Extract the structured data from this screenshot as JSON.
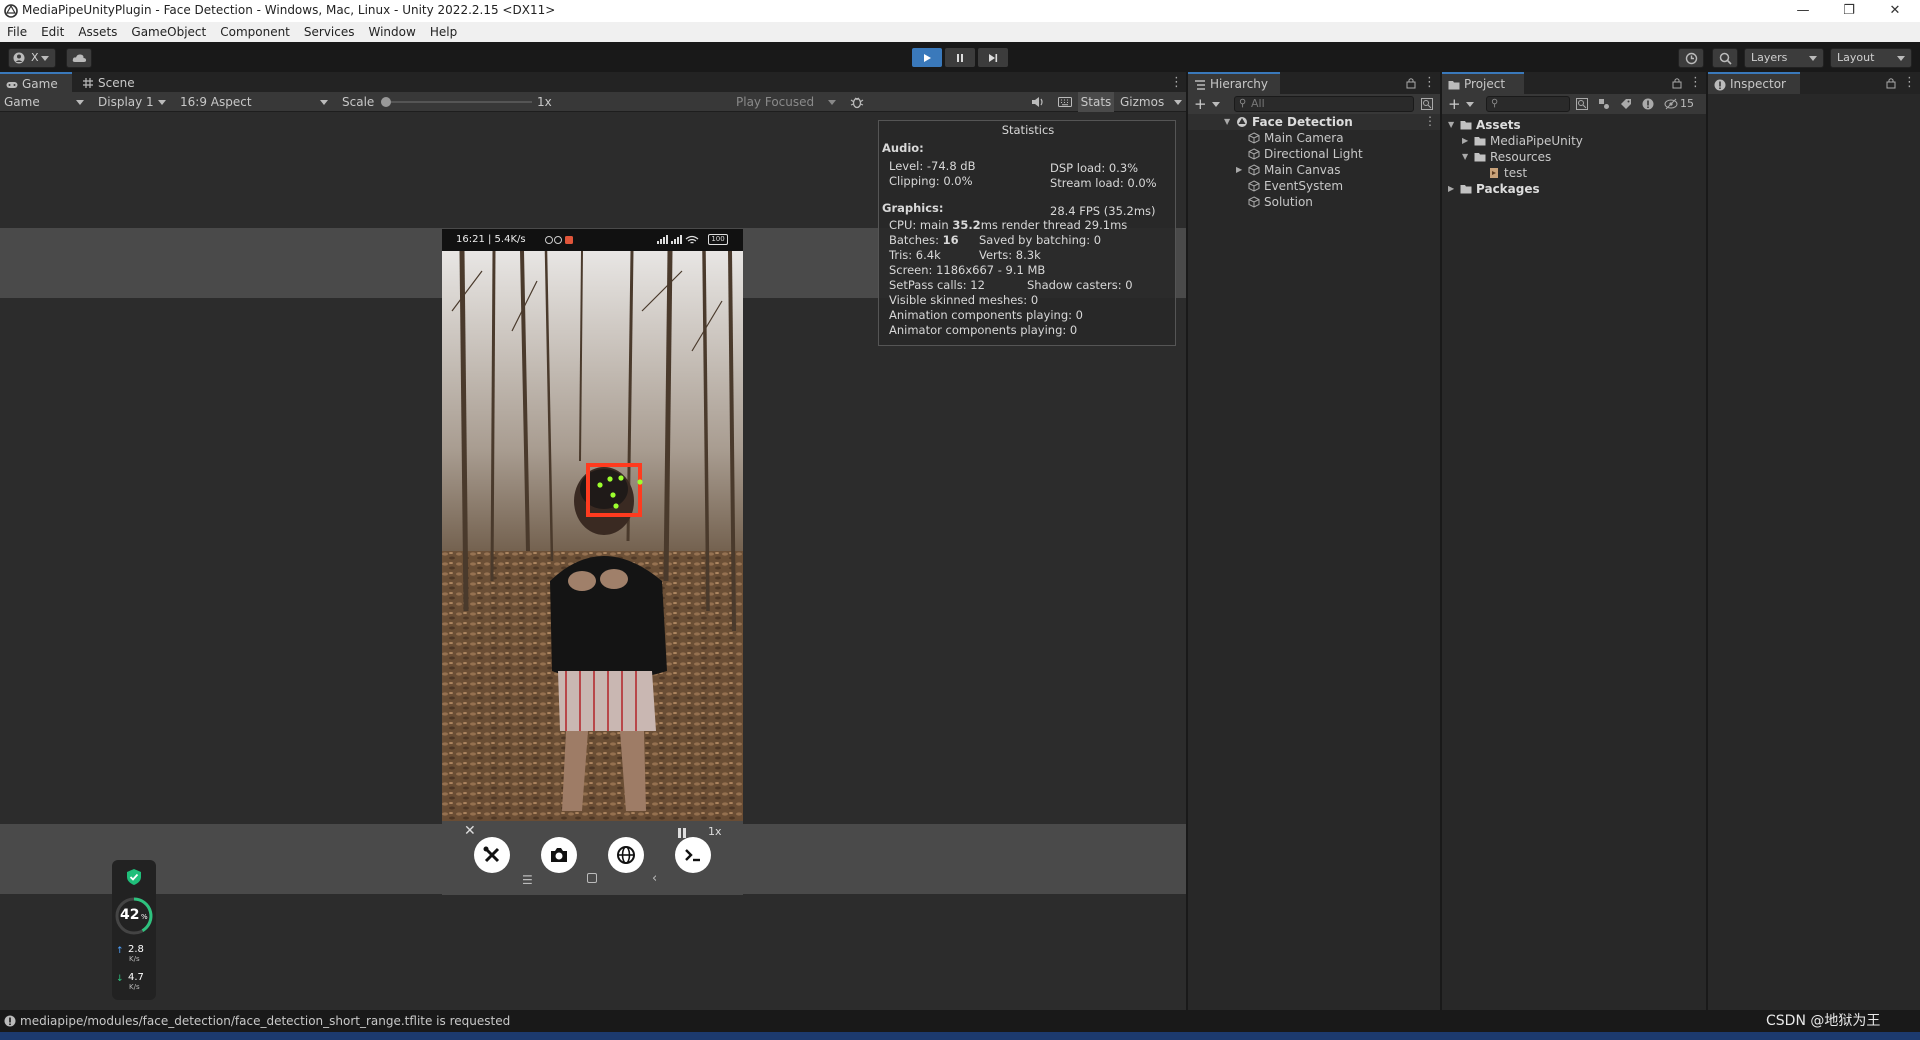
{
  "window": {
    "title": "MediaPipeUnityPlugin - Face Detection - Windows, Mac, Linux - Unity 2022.2.15 <DX11>",
    "minimize": "—",
    "restore": "❐",
    "close": "✕"
  },
  "menu": [
    "File",
    "Edit",
    "Assets",
    "GameObject",
    "Component",
    "Services",
    "Window",
    "Help"
  ],
  "toolbar": {
    "account_label": "X",
    "layers_label": "Layers",
    "layout_label": "Layout"
  },
  "tabs": {
    "game": "Game",
    "scene": "Scene",
    "hierarchy": "Hierarchy",
    "project": "Project",
    "inspector": "Inspector"
  },
  "game_toolbar": {
    "view_mode": "Game",
    "display": "Display 1",
    "aspect": "16:9 Aspect",
    "scale_label": "Scale",
    "scale_value": "1x",
    "play_mode": "Play Focused",
    "stats_label": "Stats",
    "gizmos_label": "Gizmos"
  },
  "phone": {
    "status_left": "16:21 | 5.4K/s",
    "battery": "100",
    "speed": "1x"
  },
  "stats": {
    "title": "Statistics",
    "audio_header": "Audio:",
    "level": "Level: -74.8 dB",
    "dsp_load": "DSP load: 0.3%",
    "clipping": "Clipping: 0.0%",
    "stream_load": "Stream load: 0.0%",
    "graphics_header": "Graphics:",
    "fps": "28.4 FPS (35.2ms)",
    "cpu_prefix": "CPU: main ",
    "cpu_main": "35.2",
    "cpu_suffix": "ms  render thread 29.1ms",
    "batches_prefix": "Batches: ",
    "batches": "16",
    "saved_by_batching": "Saved by batching: 0",
    "tris": "Tris: 6.4k",
    "verts": "Verts: 8.3k",
    "screen": "Screen: 1186x667 - 9.1 MB",
    "setpass": "SetPass calls: 12",
    "shadow_casters": "Shadow casters: 0",
    "skinned_meshes": "Visible skinned meshes: 0",
    "animation_components": "Animation components playing: 0",
    "animator_components": "Animator components playing: 0"
  },
  "hierarchy": {
    "search_placeholder": "All",
    "scene": "Face Detection",
    "items": [
      "Main Camera",
      "Directional Light",
      "Main Canvas",
      "EventSystem",
      "Solution"
    ]
  },
  "project": {
    "hidden_count": "15",
    "tree": {
      "assets": "Assets",
      "mediapipe_unity": "MediaPipeUnity",
      "resources": "Resources",
      "test": "test",
      "packages": "Packages"
    }
  },
  "perf_widget": {
    "cpu_percent": "42",
    "percent_sign": "%",
    "upload": "2.8",
    "download": "4.7",
    "unit": "K/s"
  },
  "statusbar": {
    "message": "mediapipe/modules/face_detection/face_detection_short_range.tflite is requested"
  },
  "watermark": "CSDN @地狱为王",
  "colors": {
    "accent": "#3a79bb",
    "detection_box": "#ff3b1f",
    "landmark": "#9cff2e",
    "play_active": "#3a79bb"
  }
}
